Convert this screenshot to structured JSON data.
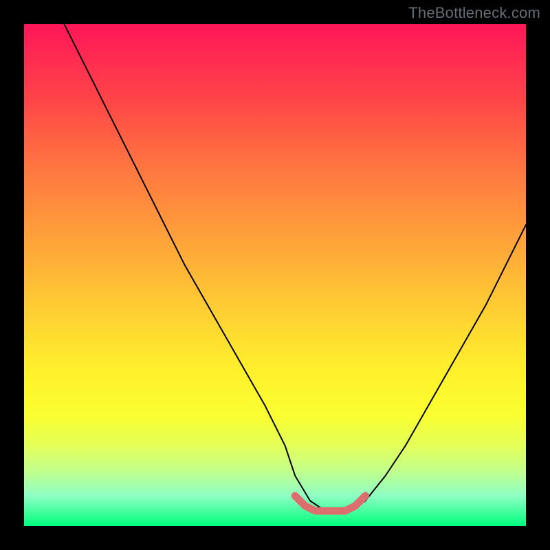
{
  "watermark": "TheBottleneck.com",
  "chart_data": {
    "type": "line",
    "title": "",
    "xlabel": "",
    "ylabel": "",
    "xlim": [
      0,
      100
    ],
    "ylim": [
      0,
      100
    ],
    "grid": false,
    "legend": false,
    "description": "Bottleneck percentage curve descending to a minimum region then rising, over a red-to-green vertical gradient where green (bottom) indicates no bottleneck.",
    "series": [
      {
        "name": "bottleneck-curve",
        "color": "#000000",
        "x": [
          8,
          12,
          16,
          20,
          24,
          28,
          32,
          36,
          40,
          44,
          48,
          52,
          54,
          57,
          60,
          62,
          65,
          68,
          72,
          76,
          80,
          84,
          88,
          92,
          96,
          100
        ],
        "y": [
          100,
          92,
          84,
          76,
          68,
          60,
          52,
          45,
          38,
          31,
          24,
          16,
          10,
          5,
          3,
          3,
          3,
          5,
          10,
          16,
          23,
          30,
          37,
          44,
          52,
          60
        ]
      },
      {
        "name": "minimum-highlight",
        "color": "#e07070",
        "x": [
          54,
          56,
          58,
          60,
          62,
          64,
          66,
          68
        ],
        "y": [
          6,
          4,
          3,
          3,
          3,
          3,
          4,
          6
        ]
      }
    ],
    "gradient_stops": [
      {
        "pct": 0,
        "color": "#ff1658"
      },
      {
        "pct": 50,
        "color": "#ffc534"
      },
      {
        "pct": 85,
        "color": "#e4ff58"
      },
      {
        "pct": 100,
        "color": "#00ff7c"
      }
    ]
  }
}
